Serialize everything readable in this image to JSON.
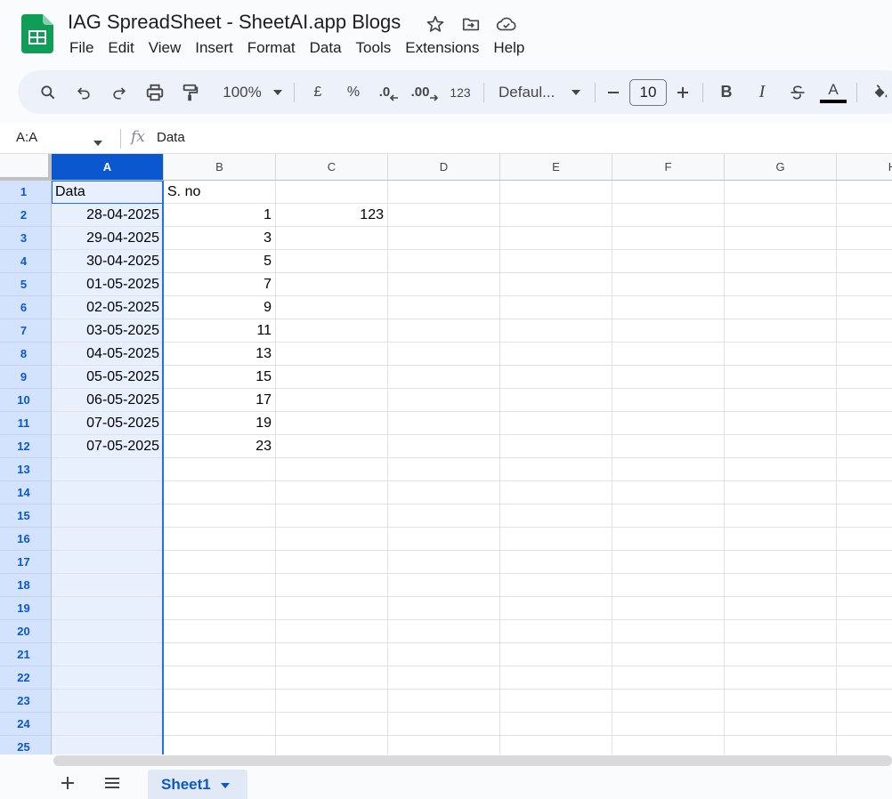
{
  "app": {
    "title": "IAG SpreadSheet - SheetAI.app Blogs",
    "brand_color": "#0f9d58",
    "accent_color": "#0b57d0"
  },
  "title_icons": [
    "star-icon",
    "move-to-folder-icon",
    "cloud-saved-icon"
  ],
  "menu": [
    "File",
    "Edit",
    "View",
    "Insert",
    "Format",
    "Data",
    "Tools",
    "Extensions",
    "Help"
  ],
  "toolbar": {
    "zoom": "100%",
    "currency": "£",
    "percent": "%",
    "decrease_decimal": ".0",
    "increase_decimal": ".00",
    "number_format": "123",
    "font": "Defaul...",
    "font_size": "10",
    "bold": "B",
    "italic": "I",
    "text_color": "A",
    "icons": [
      "search-icon",
      "undo-icon",
      "redo-icon",
      "print-icon",
      "paint-format-icon",
      "strikethrough-icon",
      "fill-color-icon"
    ]
  },
  "formula_bar": {
    "name_box": "A:A",
    "fx": "fx",
    "value": "Data"
  },
  "grid": {
    "selected_column": "A",
    "columns": [
      "A",
      "B",
      "C",
      "D",
      "E",
      "F",
      "G",
      "H"
    ],
    "rows": [
      "1",
      "2",
      "3",
      "4",
      "5",
      "6",
      "7",
      "8",
      "9",
      "10",
      "11",
      "12",
      "13",
      "14",
      "15",
      "16",
      "17",
      "18",
      "19",
      "20",
      "21",
      "22",
      "23",
      "24",
      "25"
    ],
    "cells": {
      "A": [
        "Data",
        "28-04-2025",
        "29-04-2025",
        "30-04-2025",
        "01-05-2025",
        "02-05-2025",
        "03-05-2025",
        "04-05-2025",
        "05-05-2025",
        "06-05-2025",
        "07-05-2025",
        "07-05-2025"
      ],
      "B": [
        "S. no",
        "1",
        "3",
        "5",
        "7",
        "9",
        "11",
        "13",
        "15",
        "17",
        "19",
        "23"
      ],
      "C": [
        "",
        "123"
      ]
    }
  },
  "sheets": {
    "tabs": [
      "Sheet1"
    ],
    "add_icon": "plus-icon",
    "list_icon": "all-sheets-icon"
  }
}
